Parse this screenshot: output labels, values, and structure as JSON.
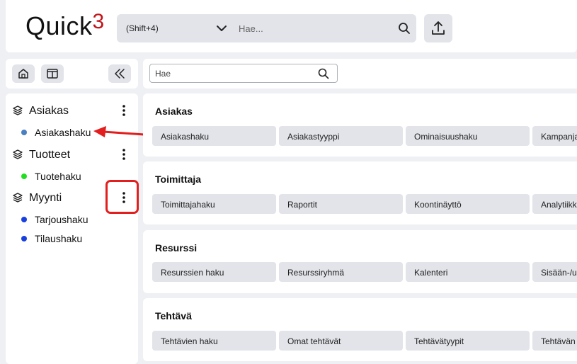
{
  "header": {
    "logo_text": "Quick",
    "logo_super": "3",
    "shortcut": "(Shift+4)",
    "search_placeholder": "Hae...",
    "icons": [
      "chevron-down-icon",
      "search-icon",
      "export-icon"
    ]
  },
  "toolbar": {
    "icons": [
      "home-icon",
      "columns-layout-icon",
      "collapse-double-chevron-icon"
    ]
  },
  "main_search": {
    "placeholder": "Hae"
  },
  "sidebar": {
    "groups": [
      {
        "label": "Asiakas",
        "items": [
          {
            "label": "Asiakashaku",
            "dot_color": "#4a7fc1"
          }
        ]
      },
      {
        "label": "Tuotteet",
        "items": [
          {
            "label": "Tuotehaku",
            "dot_color": "#22dd22"
          }
        ]
      },
      {
        "label": "Myynti",
        "items": [
          {
            "label": "Tarjoushaku",
            "dot_color": "#1a3fe0"
          },
          {
            "label": "Tilaushaku",
            "dot_color": "#1a3fe0"
          }
        ]
      }
    ]
  },
  "sections": [
    {
      "title": "Asiakas",
      "pills": [
        "Asiakashaku",
        "Asiakastyyppi",
        "Ominaisuushaku",
        "Kampanja"
      ]
    },
    {
      "title": "Toimittaja",
      "pills": [
        "Toimittajahaku",
        "Raportit",
        "Koontinäyttö",
        "Analytiikk"
      ]
    },
    {
      "title": "Resurssi",
      "pills": [
        "Resurssien haku",
        "Resurssiryhmä",
        "Kalenteri",
        "Sisään-/u"
      ]
    },
    {
      "title": "Tehtävä",
      "pills": [
        "Tehtävien haku",
        "Omat tehtävät",
        "Tehtävätyypit",
        "Tehtävän"
      ]
    }
  ],
  "annotation_color": "#e31e1e"
}
